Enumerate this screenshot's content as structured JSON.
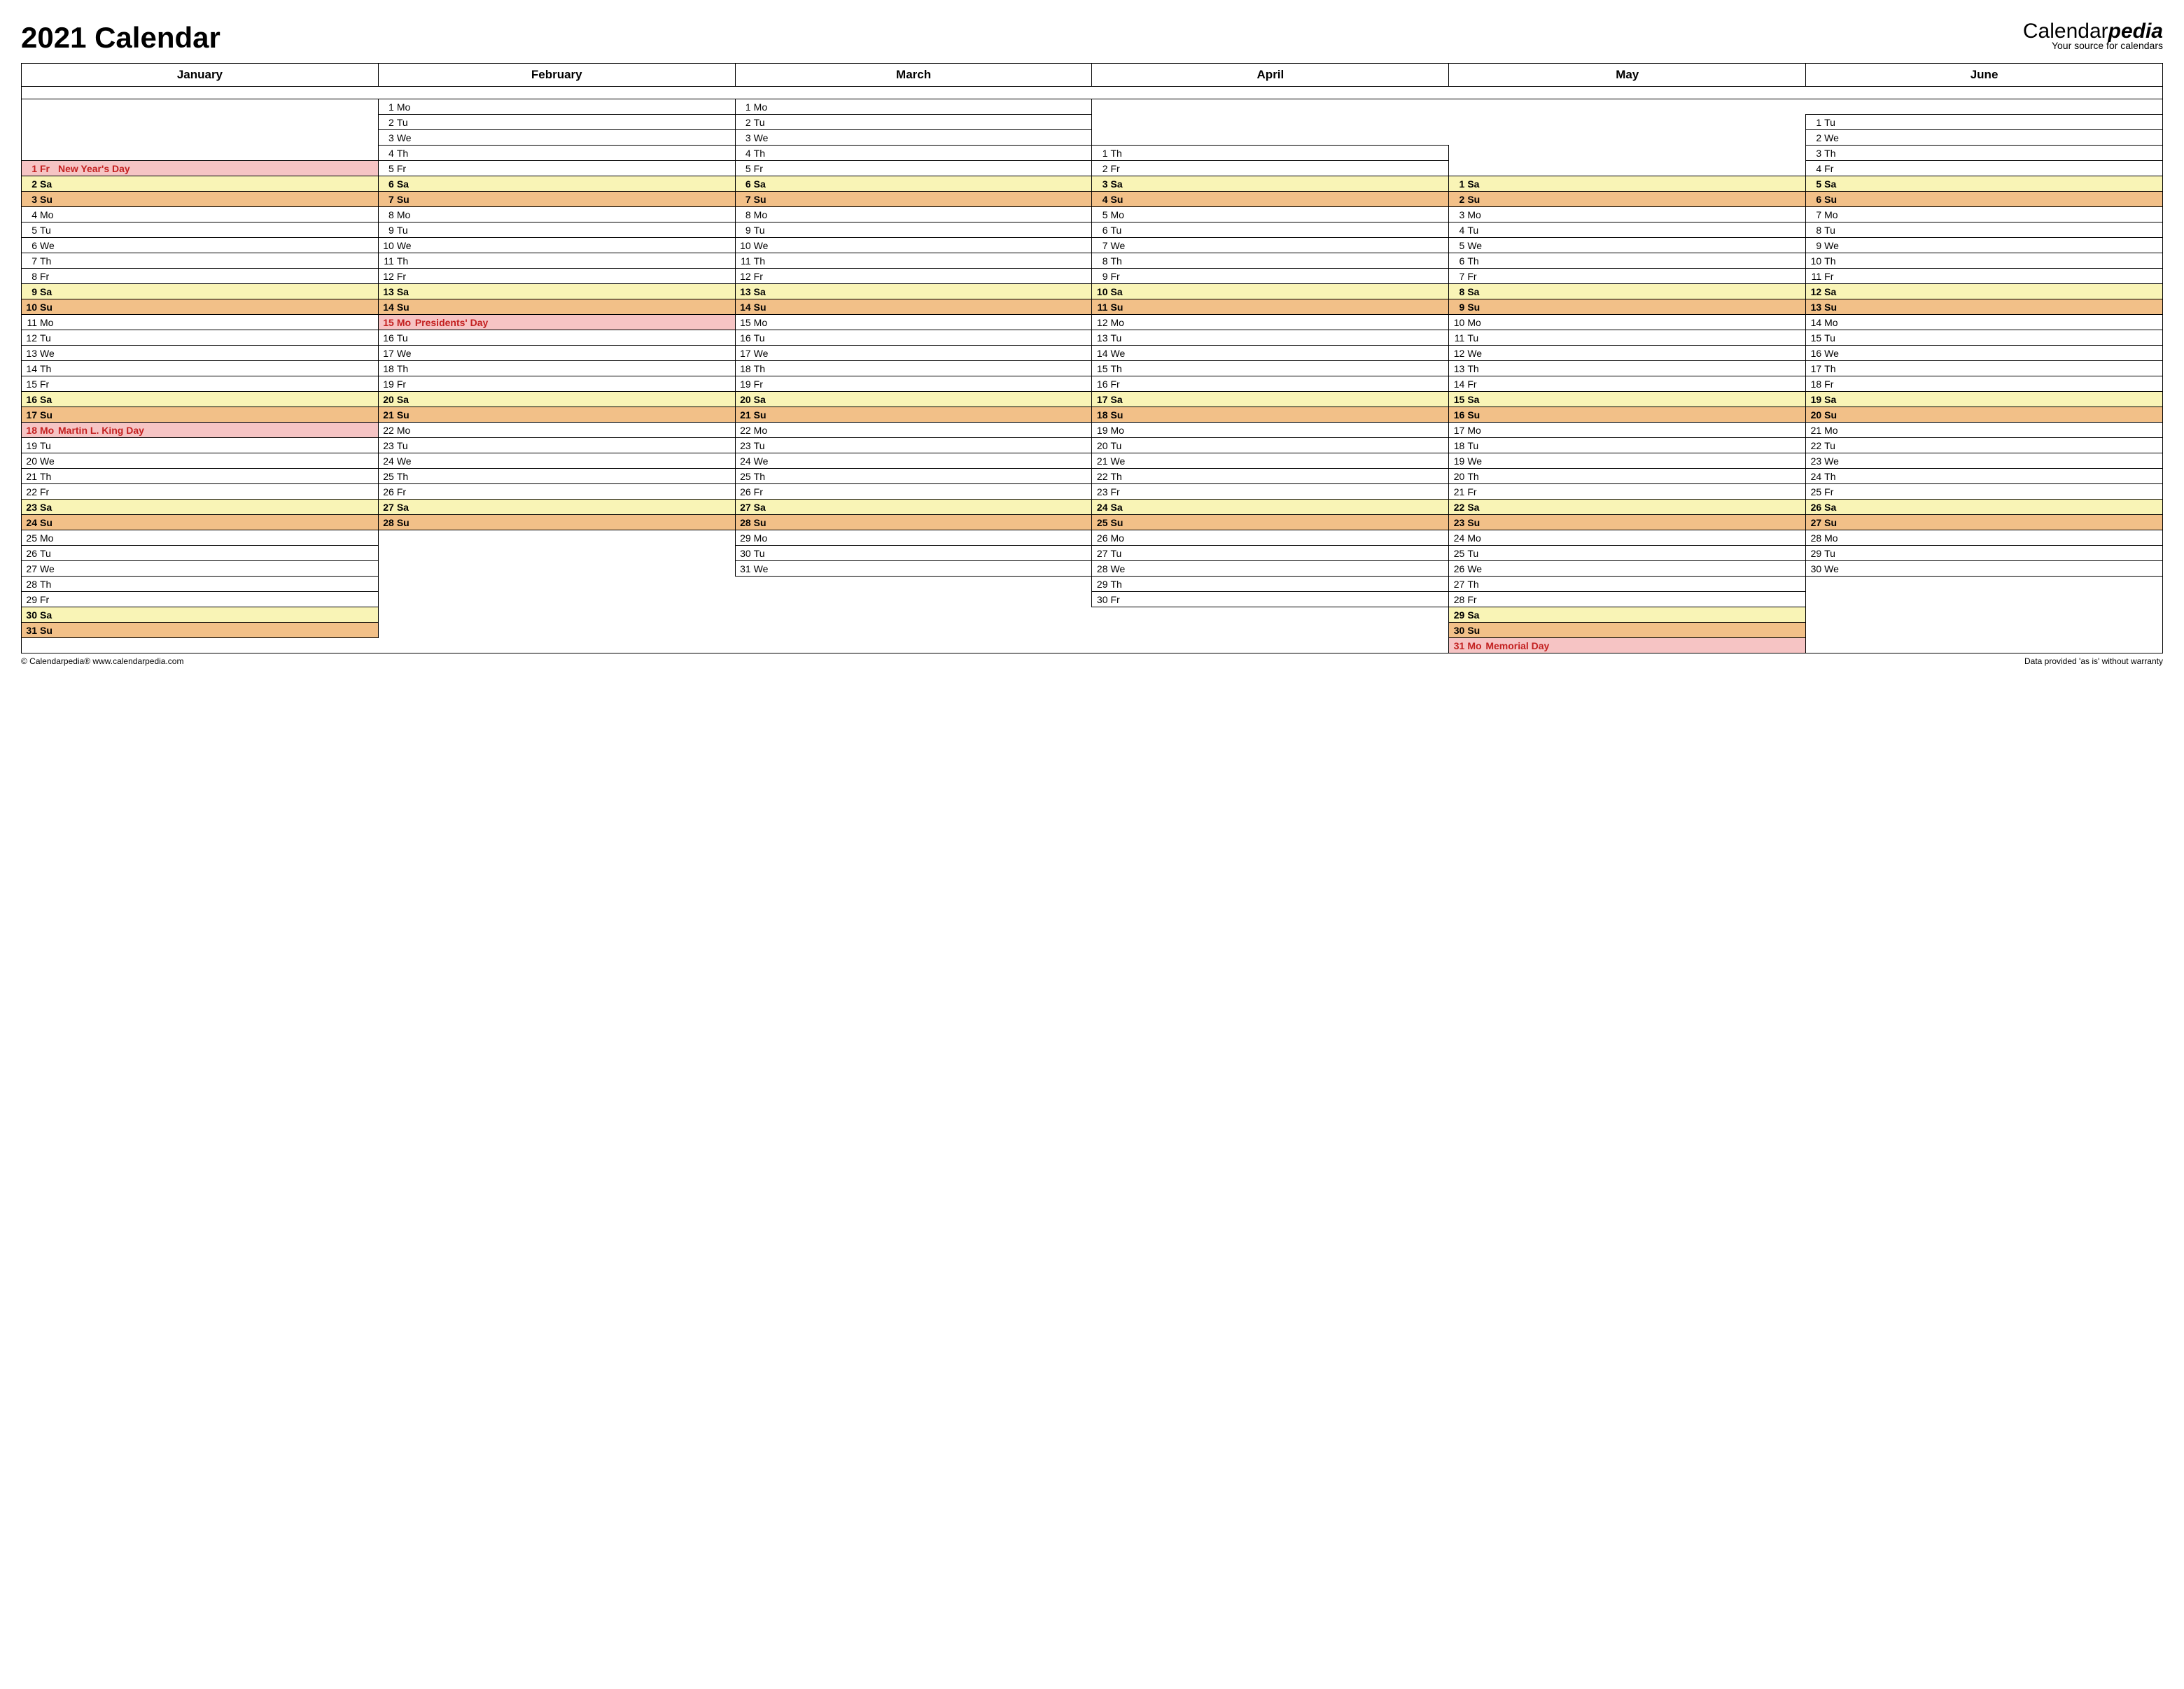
{
  "title": "2021 Calendar",
  "logo": {
    "part1": "Calendar",
    "part2": "pedia",
    "sub": "Your source for calendars"
  },
  "months": [
    "January",
    "February",
    "March",
    "April",
    "May",
    "June"
  ],
  "rows": [
    [
      null,
      {
        "d": 1,
        "w": "Mo"
      },
      {
        "d": 1,
        "w": "Mo"
      },
      null,
      null,
      null
    ],
    [
      null,
      {
        "d": 2,
        "w": "Tu"
      },
      {
        "d": 2,
        "w": "Tu"
      },
      null,
      null,
      {
        "d": 1,
        "w": "Tu"
      }
    ],
    [
      null,
      {
        "d": 3,
        "w": "We"
      },
      {
        "d": 3,
        "w": "We"
      },
      null,
      null,
      {
        "d": 2,
        "w": "We"
      }
    ],
    [
      null,
      {
        "d": 4,
        "w": "Th"
      },
      {
        "d": 4,
        "w": "Th"
      },
      {
        "d": 1,
        "w": "Th"
      },
      null,
      {
        "d": 3,
        "w": "Th"
      }
    ],
    [
      {
        "d": 1,
        "w": "Fr",
        "ev": "New Year's Day",
        "t": "hol"
      },
      {
        "d": 5,
        "w": "Fr"
      },
      {
        "d": 5,
        "w": "Fr"
      },
      {
        "d": 2,
        "w": "Fr"
      },
      null,
      {
        "d": 4,
        "w": "Fr"
      }
    ],
    [
      {
        "d": 2,
        "w": "Sa",
        "t": "sa"
      },
      {
        "d": 6,
        "w": "Sa",
        "t": "sa"
      },
      {
        "d": 6,
        "w": "Sa",
        "t": "sa"
      },
      {
        "d": 3,
        "w": "Sa",
        "t": "sa"
      },
      {
        "d": 1,
        "w": "Sa",
        "t": "sa"
      },
      {
        "d": 5,
        "w": "Sa",
        "t": "sa"
      }
    ],
    [
      {
        "d": 3,
        "w": "Su",
        "t": "su"
      },
      {
        "d": 7,
        "w": "Su",
        "t": "su"
      },
      {
        "d": 7,
        "w": "Su",
        "t": "su"
      },
      {
        "d": 4,
        "w": "Su",
        "t": "su"
      },
      {
        "d": 2,
        "w": "Su",
        "t": "su"
      },
      {
        "d": 6,
        "w": "Su",
        "t": "su"
      }
    ],
    [
      {
        "d": 4,
        "w": "Mo"
      },
      {
        "d": 8,
        "w": "Mo"
      },
      {
        "d": 8,
        "w": "Mo"
      },
      {
        "d": 5,
        "w": "Mo"
      },
      {
        "d": 3,
        "w": "Mo"
      },
      {
        "d": 7,
        "w": "Mo"
      }
    ],
    [
      {
        "d": 5,
        "w": "Tu"
      },
      {
        "d": 9,
        "w": "Tu"
      },
      {
        "d": 9,
        "w": "Tu"
      },
      {
        "d": 6,
        "w": "Tu"
      },
      {
        "d": 4,
        "w": "Tu"
      },
      {
        "d": 8,
        "w": "Tu"
      }
    ],
    [
      {
        "d": 6,
        "w": "We"
      },
      {
        "d": 10,
        "w": "We"
      },
      {
        "d": 10,
        "w": "We"
      },
      {
        "d": 7,
        "w": "We"
      },
      {
        "d": 5,
        "w": "We"
      },
      {
        "d": 9,
        "w": "We"
      }
    ],
    [
      {
        "d": 7,
        "w": "Th"
      },
      {
        "d": 11,
        "w": "Th"
      },
      {
        "d": 11,
        "w": "Th"
      },
      {
        "d": 8,
        "w": "Th"
      },
      {
        "d": 6,
        "w": "Th"
      },
      {
        "d": 10,
        "w": "Th"
      }
    ],
    [
      {
        "d": 8,
        "w": "Fr"
      },
      {
        "d": 12,
        "w": "Fr"
      },
      {
        "d": 12,
        "w": "Fr"
      },
      {
        "d": 9,
        "w": "Fr"
      },
      {
        "d": 7,
        "w": "Fr"
      },
      {
        "d": 11,
        "w": "Fr"
      }
    ],
    [
      {
        "d": 9,
        "w": "Sa",
        "t": "sa"
      },
      {
        "d": 13,
        "w": "Sa",
        "t": "sa"
      },
      {
        "d": 13,
        "w": "Sa",
        "t": "sa"
      },
      {
        "d": 10,
        "w": "Sa",
        "t": "sa"
      },
      {
        "d": 8,
        "w": "Sa",
        "t": "sa"
      },
      {
        "d": 12,
        "w": "Sa",
        "t": "sa"
      }
    ],
    [
      {
        "d": 10,
        "w": "Su",
        "t": "su"
      },
      {
        "d": 14,
        "w": "Su",
        "t": "su"
      },
      {
        "d": 14,
        "w": "Su",
        "t": "su"
      },
      {
        "d": 11,
        "w": "Su",
        "t": "su"
      },
      {
        "d": 9,
        "w": "Su",
        "t": "su"
      },
      {
        "d": 13,
        "w": "Su",
        "t": "su"
      }
    ],
    [
      {
        "d": 11,
        "w": "Mo"
      },
      {
        "d": 15,
        "w": "Mo",
        "ev": "Presidents' Day",
        "t": "hol"
      },
      {
        "d": 15,
        "w": "Mo"
      },
      {
        "d": 12,
        "w": "Mo"
      },
      {
        "d": 10,
        "w": "Mo"
      },
      {
        "d": 14,
        "w": "Mo"
      }
    ],
    [
      {
        "d": 12,
        "w": "Tu"
      },
      {
        "d": 16,
        "w": "Tu"
      },
      {
        "d": 16,
        "w": "Tu"
      },
      {
        "d": 13,
        "w": "Tu"
      },
      {
        "d": 11,
        "w": "Tu"
      },
      {
        "d": 15,
        "w": "Tu"
      }
    ],
    [
      {
        "d": 13,
        "w": "We"
      },
      {
        "d": 17,
        "w": "We"
      },
      {
        "d": 17,
        "w": "We"
      },
      {
        "d": 14,
        "w": "We"
      },
      {
        "d": 12,
        "w": "We"
      },
      {
        "d": 16,
        "w": "We"
      }
    ],
    [
      {
        "d": 14,
        "w": "Th"
      },
      {
        "d": 18,
        "w": "Th"
      },
      {
        "d": 18,
        "w": "Th"
      },
      {
        "d": 15,
        "w": "Th"
      },
      {
        "d": 13,
        "w": "Th"
      },
      {
        "d": 17,
        "w": "Th"
      }
    ],
    [
      {
        "d": 15,
        "w": "Fr"
      },
      {
        "d": 19,
        "w": "Fr"
      },
      {
        "d": 19,
        "w": "Fr"
      },
      {
        "d": 16,
        "w": "Fr"
      },
      {
        "d": 14,
        "w": "Fr"
      },
      {
        "d": 18,
        "w": "Fr"
      }
    ],
    [
      {
        "d": 16,
        "w": "Sa",
        "t": "sa"
      },
      {
        "d": 20,
        "w": "Sa",
        "t": "sa"
      },
      {
        "d": 20,
        "w": "Sa",
        "t": "sa"
      },
      {
        "d": 17,
        "w": "Sa",
        "t": "sa"
      },
      {
        "d": 15,
        "w": "Sa",
        "t": "sa"
      },
      {
        "d": 19,
        "w": "Sa",
        "t": "sa"
      }
    ],
    [
      {
        "d": 17,
        "w": "Su",
        "t": "su"
      },
      {
        "d": 21,
        "w": "Su",
        "t": "su"
      },
      {
        "d": 21,
        "w": "Su",
        "t": "su"
      },
      {
        "d": 18,
        "w": "Su",
        "t": "su"
      },
      {
        "d": 16,
        "w": "Su",
        "t": "su"
      },
      {
        "d": 20,
        "w": "Su",
        "t": "su"
      }
    ],
    [
      {
        "d": 18,
        "w": "Mo",
        "ev": "Martin L. King Day",
        "t": "hol"
      },
      {
        "d": 22,
        "w": "Mo"
      },
      {
        "d": 22,
        "w": "Mo"
      },
      {
        "d": 19,
        "w": "Mo"
      },
      {
        "d": 17,
        "w": "Mo"
      },
      {
        "d": 21,
        "w": "Mo"
      }
    ],
    [
      {
        "d": 19,
        "w": "Tu"
      },
      {
        "d": 23,
        "w": "Tu"
      },
      {
        "d": 23,
        "w": "Tu"
      },
      {
        "d": 20,
        "w": "Tu"
      },
      {
        "d": 18,
        "w": "Tu"
      },
      {
        "d": 22,
        "w": "Tu"
      }
    ],
    [
      {
        "d": 20,
        "w": "We"
      },
      {
        "d": 24,
        "w": "We"
      },
      {
        "d": 24,
        "w": "We"
      },
      {
        "d": 21,
        "w": "We"
      },
      {
        "d": 19,
        "w": "We"
      },
      {
        "d": 23,
        "w": "We"
      }
    ],
    [
      {
        "d": 21,
        "w": "Th"
      },
      {
        "d": 25,
        "w": "Th"
      },
      {
        "d": 25,
        "w": "Th"
      },
      {
        "d": 22,
        "w": "Th"
      },
      {
        "d": 20,
        "w": "Th"
      },
      {
        "d": 24,
        "w": "Th"
      }
    ],
    [
      {
        "d": 22,
        "w": "Fr"
      },
      {
        "d": 26,
        "w": "Fr"
      },
      {
        "d": 26,
        "w": "Fr"
      },
      {
        "d": 23,
        "w": "Fr"
      },
      {
        "d": 21,
        "w": "Fr"
      },
      {
        "d": 25,
        "w": "Fr"
      }
    ],
    [
      {
        "d": 23,
        "w": "Sa",
        "t": "sa"
      },
      {
        "d": 27,
        "w": "Sa",
        "t": "sa"
      },
      {
        "d": 27,
        "w": "Sa",
        "t": "sa"
      },
      {
        "d": 24,
        "w": "Sa",
        "t": "sa"
      },
      {
        "d": 22,
        "w": "Sa",
        "t": "sa"
      },
      {
        "d": 26,
        "w": "Sa",
        "t": "sa"
      }
    ],
    [
      {
        "d": 24,
        "w": "Su",
        "t": "su"
      },
      {
        "d": 28,
        "w": "Su",
        "t": "su"
      },
      {
        "d": 28,
        "w": "Su",
        "t": "su"
      },
      {
        "d": 25,
        "w": "Su",
        "t": "su"
      },
      {
        "d": 23,
        "w": "Su",
        "t": "su"
      },
      {
        "d": 27,
        "w": "Su",
        "t": "su"
      }
    ],
    [
      {
        "d": 25,
        "w": "Mo"
      },
      null,
      {
        "d": 29,
        "w": "Mo"
      },
      {
        "d": 26,
        "w": "Mo"
      },
      {
        "d": 24,
        "w": "Mo"
      },
      {
        "d": 28,
        "w": "Mo"
      }
    ],
    [
      {
        "d": 26,
        "w": "Tu"
      },
      null,
      {
        "d": 30,
        "w": "Tu"
      },
      {
        "d": 27,
        "w": "Tu"
      },
      {
        "d": 25,
        "w": "Tu"
      },
      {
        "d": 29,
        "w": "Tu"
      }
    ],
    [
      {
        "d": 27,
        "w": "We"
      },
      null,
      {
        "d": 31,
        "w": "We"
      },
      {
        "d": 28,
        "w": "We"
      },
      {
        "d": 26,
        "w": "We"
      },
      {
        "d": 30,
        "w": "We"
      }
    ],
    [
      {
        "d": 28,
        "w": "Th"
      },
      null,
      null,
      {
        "d": 29,
        "w": "Th"
      },
      {
        "d": 27,
        "w": "Th"
      },
      null
    ],
    [
      {
        "d": 29,
        "w": "Fr"
      },
      null,
      null,
      {
        "d": 30,
        "w": "Fr"
      },
      {
        "d": 28,
        "w": "Fr"
      },
      null
    ],
    [
      {
        "d": 30,
        "w": "Sa",
        "t": "sa"
      },
      null,
      null,
      null,
      {
        "d": 29,
        "w": "Sa",
        "t": "sa"
      },
      null
    ],
    [
      {
        "d": 31,
        "w": "Su",
        "t": "su"
      },
      null,
      null,
      null,
      {
        "d": 30,
        "w": "Su",
        "t": "su"
      },
      null
    ],
    [
      null,
      null,
      null,
      null,
      {
        "d": 31,
        "w": "Mo",
        "ev": "Memorial Day",
        "t": "hol"
      },
      null
    ]
  ],
  "footer": {
    "left": "© Calendarpedia®   www.calendarpedia.com",
    "right": "Data provided 'as is' without warranty"
  }
}
